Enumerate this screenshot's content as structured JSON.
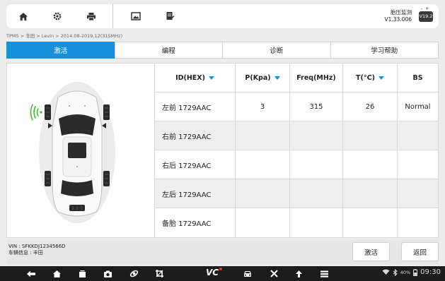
{
  "toolbar": {
    "icons": [
      "home-icon",
      "settings-icon",
      "print-icon",
      "image-icon",
      "edit-note-icon"
    ],
    "app_name": "胎压监测",
    "app_version": "V1.33.006",
    "version_badge": "V19.2"
  },
  "breadcrumb": "TPMS > 丰田 > Levin > 2014.08-2019.12(315MHz)",
  "tabs": [
    {
      "label": "激活",
      "active": true
    },
    {
      "label": "编程",
      "active": false
    },
    {
      "label": "诊断",
      "active": false
    },
    {
      "label": "学习帮助",
      "active": false
    }
  ],
  "table": {
    "headers": [
      "ID(HEX)",
      "P(Kpa)",
      "Freq(MHz)",
      "T(°C)",
      "BS"
    ],
    "sortable": [
      true,
      true,
      false,
      true,
      false
    ],
    "rows": [
      [
        "左前 1729AAC",
        "3",
        "315",
        "26",
        "Normal"
      ],
      [
        "右前 1729AAC",
        "",
        "",
        "",
        ""
      ],
      [
        "右后 1729AAC",
        "",
        "",
        "",
        ""
      ],
      [
        "左后 1729AAC",
        "",
        "",
        "",
        ""
      ],
      [
        "备胎 1729AAC",
        "",
        "",
        "",
        ""
      ]
    ]
  },
  "vehicle": {
    "vin": "VIN : SFKKDJ1234566D",
    "info": "车辆信息 : 丰田"
  },
  "buttons": {
    "activate": "激活",
    "back": "返回"
  },
  "navbar": {
    "vc_label": "VC",
    "battery": "40%",
    "time": "09:30"
  },
  "colors": {
    "accent": "#1591d9",
    "signal": "#2fbf1f"
  }
}
